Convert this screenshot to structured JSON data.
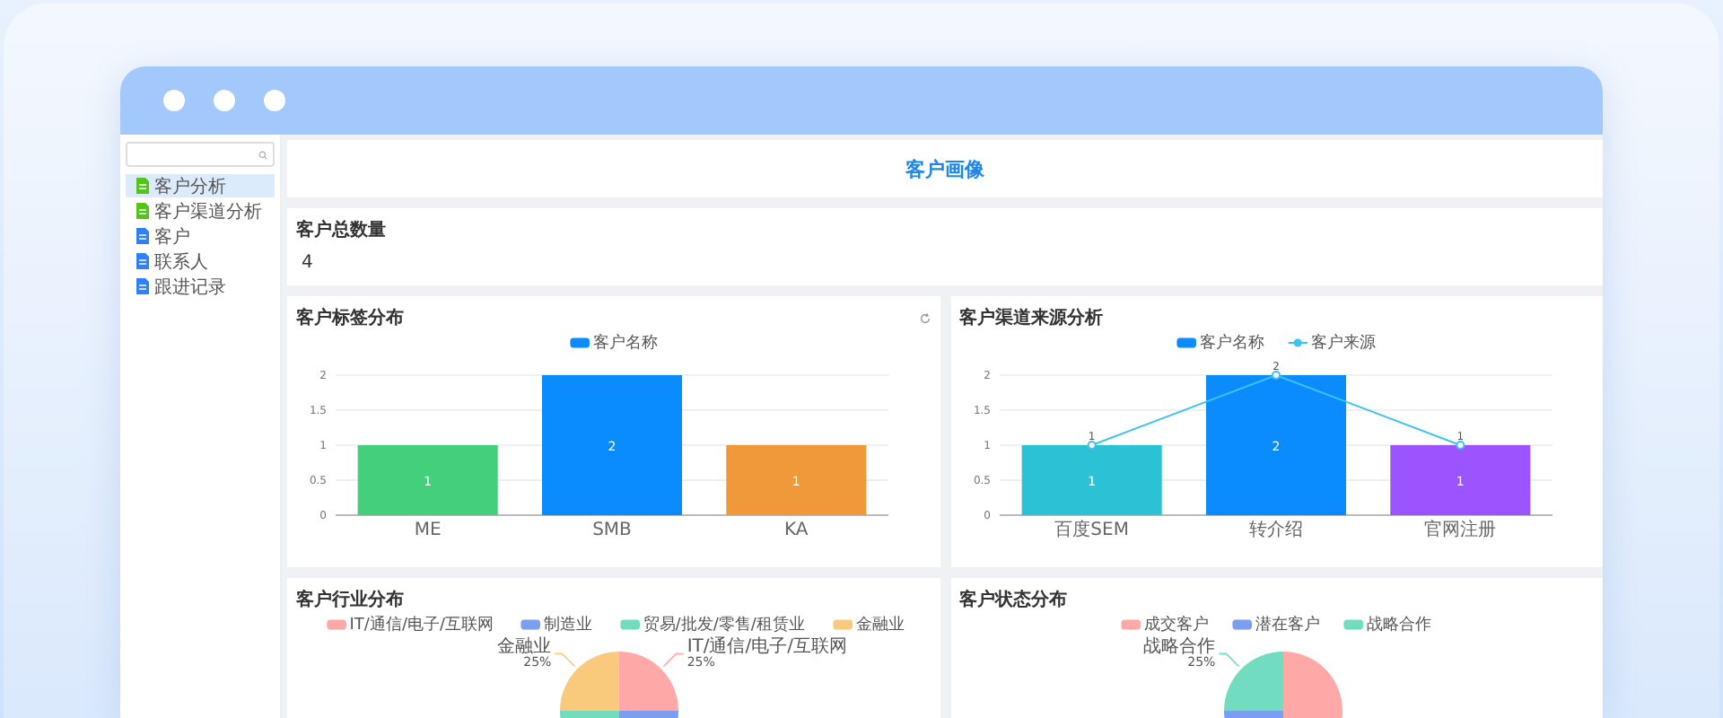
{
  "sidebar": {
    "items": [
      {
        "label": "客户分析",
        "selected": true,
        "color": "#52c41a"
      },
      {
        "label": "客户渠道分析",
        "selected": false,
        "color": "#52c41a"
      },
      {
        "label": "客户",
        "selected": false,
        "color": "#2f7fff"
      },
      {
        "label": "联系人",
        "selected": false,
        "color": "#2f7fff"
      },
      {
        "label": "跟进记录",
        "selected": false,
        "color": "#2f7fff"
      }
    ]
  },
  "header": {
    "title": "客户画像"
  },
  "total": {
    "title": "客户总数量",
    "value": "4"
  },
  "charts": [
    {
      "title": "客户标签分布",
      "refresh": true,
      "legend": [
        {
          "color": "#0a8cff"
        }
      ],
      "chart_data": {
        "type": "bar",
        "categories": [
          "ME",
          "SMB",
          "KA"
        ],
        "ylim": [
          0,
          2
        ],
        "yticks": [
          0,
          0.5,
          1,
          1.5,
          2
        ],
        "grid": true,
        "data_labels": true,
        "series": [
          {
            "name": "客户名称",
            "colors": [
              "#44cf7c",
              "#0a8cff",
              "#f0993a"
            ],
            "values": [
              1,
              2,
              1
            ]
          }
        ]
      }
    },
    {
      "title": "客户渠道来源分析",
      "refresh": false,
      "legend": [
        {
          "color": "#0a8cff"
        },
        {
          "color": "#3cc3f0"
        }
      ],
      "chart_data": {
        "type": "bar",
        "categories": [
          "百度SEM",
          "转介绍",
          "官网注册"
        ],
        "ylim": [
          0,
          2
        ],
        "yticks": [
          0,
          0.5,
          1,
          1.5,
          2
        ],
        "grid": true,
        "series": [
          {
            "name": "客户名称",
            "colors": [
              "#2cc2d6",
              "#0a8cff",
              "#9b54ff"
            ],
            "values": [
              1,
              2,
              1
            ],
            "value_labels": [
              "1",
              "2",
              "1"
            ]
          },
          {
            "name": "客户来源",
            "type": "line",
            "color": "#3cc3f0",
            "marker": "circle",
            "values": [
              1,
              2,
              1
            ],
            "value_labels": [
              "1",
              "2",
              "1"
            ]
          }
        ]
      }
    }
  ],
  "pies": [
    {
      "title": "客户行业分布",
      "chart_data": {
        "type": "pie",
        "categories": [
          "IT/通信/电子/互联网",
          "制造业",
          "贸易/批发/零售/租赁业",
          "金融业"
        ],
        "colors": [
          "#ffa8a8",
          "#7b9ef0",
          "#72dcc0",
          "#f9c97c"
        ],
        "values": [
          25,
          25,
          25,
          25
        ],
        "value_labels": [
          "25%",
          null,
          null,
          "25%"
        ]
      }
    },
    {
      "title": "客户状态分布",
      "chart_data": {
        "type": "pie",
        "categories": [
          "成交客户",
          "潜在客户",
          "战略合作"
        ],
        "colors": [
          "#ffa8a8",
          "#7b9ef0",
          "#72dcc0"
        ],
        "values": [
          50,
          25,
          25
        ],
        "value_labels": [
          null,
          null,
          "25%"
        ]
      }
    }
  ]
}
